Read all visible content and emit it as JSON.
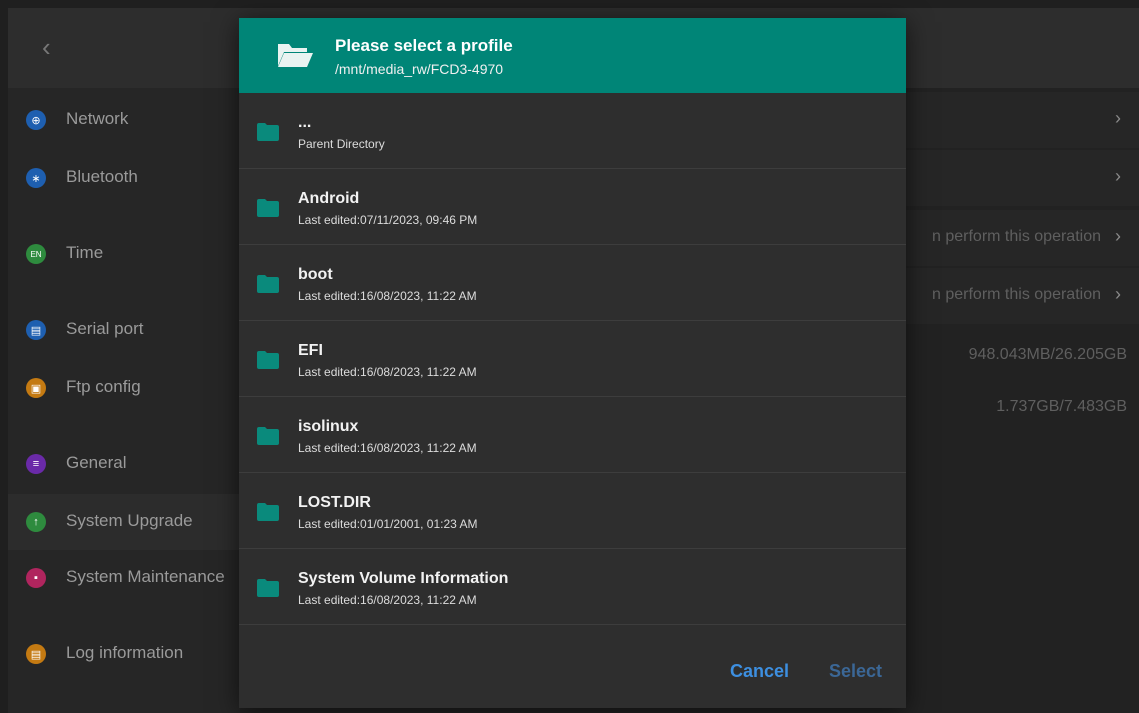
{
  "background": {
    "sidebar": [
      {
        "icon": "globe-icon",
        "label": "Network",
        "color": "#1e5fb0"
      },
      {
        "icon": "bluetooth-icon",
        "label": "Bluetooth",
        "color": "#1e5fb0"
      },
      {
        "icon": "clock-icon",
        "label": "Time",
        "color": "#2e8b3e"
      },
      {
        "icon": "serial-port-icon",
        "label": "Serial port",
        "color": "#1e5fb0"
      },
      {
        "icon": "ftp-icon",
        "label": "Ftp config",
        "color": "#c47a12"
      },
      {
        "icon": "general-icon",
        "label": "General",
        "color": "#6a2aa8"
      },
      {
        "icon": "upgrade-icon",
        "label": "System Upgrade",
        "color": "#2e8b3e"
      },
      {
        "icon": "maintenance-icon",
        "label": "System Maintenance",
        "color": "#b0255e"
      },
      {
        "icon": "log-icon",
        "label": "Log information",
        "color": "#c47a12"
      }
    ],
    "rows": [
      {
        "text": "",
        "chevron": "›"
      },
      {
        "text": "",
        "chevron": "›"
      },
      {
        "text": "n perform this operation",
        "chevron": "›"
      },
      {
        "text": "n perform this operation",
        "chevron": "›"
      },
      {
        "text": "948.043MB/26.205GB"
      },
      {
        "text": "1.737GB/7.483GB"
      }
    ]
  },
  "dialog": {
    "title": "Please select a profile",
    "path": "/mnt/media_rw/FCD3-4970",
    "header_icon": "folder-open-icon",
    "accent": "#008577",
    "items": [
      {
        "name": "...",
        "subtitle": "Parent Directory"
      },
      {
        "name": "Android",
        "subtitle": "Last edited:07/11/2023, 09:46 PM"
      },
      {
        "name": "boot",
        "subtitle": "Last edited:16/08/2023, 11:22 AM"
      },
      {
        "name": "EFI",
        "subtitle": "Last edited:16/08/2023, 11:22 AM"
      },
      {
        "name": "isolinux",
        "subtitle": "Last edited:16/08/2023, 11:22 AM"
      },
      {
        "name": "LOST.DIR",
        "subtitle": "Last edited:01/01/2001, 01:23 AM"
      },
      {
        "name": "System Volume Information",
        "subtitle": "Last edited:16/08/2023, 11:22 AM"
      }
    ],
    "cancel_label": "Cancel",
    "select_label": "Select"
  }
}
